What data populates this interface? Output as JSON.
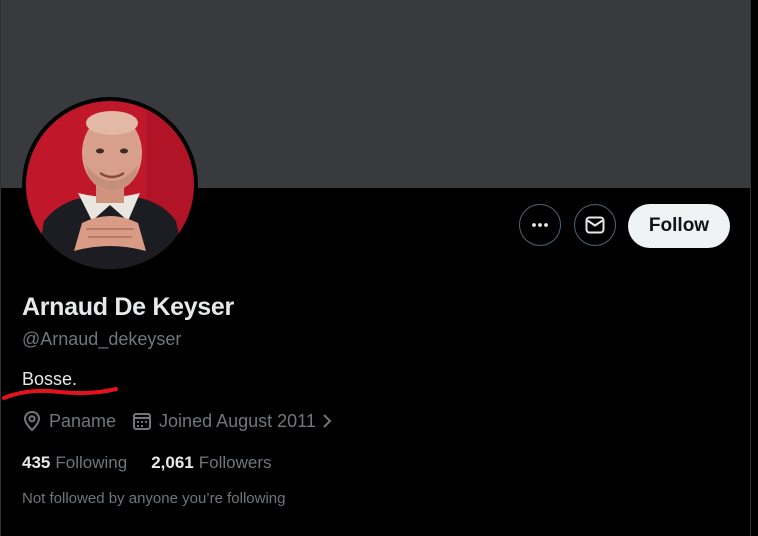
{
  "profile": {
    "display_name": "Arnaud De Keyser",
    "handle": "@Arnaud_dekeyser",
    "bio": "Bosse.",
    "location": "Paname",
    "joined": "Joined August 2011",
    "following_count": "435",
    "following_label": "Following",
    "followers_count": "2,061",
    "followers_label": "Followers",
    "followed_by_note": "Not followed by anyone you’re following"
  },
  "actions": {
    "follow_label": "Follow",
    "more_icon": "more-horizontal-icon",
    "message_icon": "envelope-icon"
  },
  "colors": {
    "background": "#000000",
    "banner": "#393a3e",
    "text_primary": "#e7e9ea",
    "text_secondary": "#71767b",
    "follow_button_bg": "#eff3f4",
    "annotation_red": "#e3131b",
    "avatar_background": "#c0182a"
  }
}
